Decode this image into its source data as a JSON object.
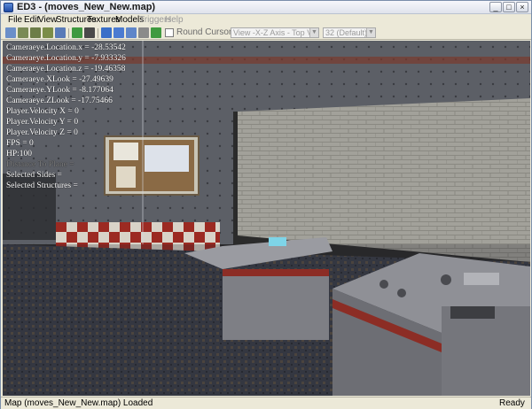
{
  "window": {
    "title": "ED3 - (moves_New_New.map)",
    "minimize_glyph": "_",
    "maximize_glyph": "□",
    "close_glyph": "×"
  },
  "menu": {
    "items": [
      {
        "label": "File",
        "enabled": true
      },
      {
        "label": "Edit",
        "enabled": true
      },
      {
        "label": "View",
        "enabled": true
      },
      {
        "label": "Structures",
        "enabled": true
      },
      {
        "label": "Textures",
        "enabled": true
      },
      {
        "label": "Models",
        "enabled": true
      },
      {
        "label": "Triggers",
        "enabled": false
      },
      {
        "label": "Help",
        "enabled": false
      }
    ]
  },
  "toolbar": {
    "round_cursor_label": "Round Cursor Position",
    "round_cursor_checked": false,
    "view_combo_value": "View -X-Z Axis - Top View",
    "grid_combo_value": "32 (Default)",
    "icons": [
      "new-icon",
      "open-icon",
      "save-icon",
      "save-all-icon",
      "import-icon",
      "export-icon",
      "compile-icon",
      "render-icon",
      "grid-icon",
      "select-icon",
      "move-icon",
      "rotate-icon",
      "scale-icon",
      "texture-icon",
      "light-icon"
    ],
    "colors": {
      "green": "#3f9a3f",
      "blue": "#3a6fc8",
      "gray": "#8a8a8a",
      "dark": "#4a4a4a"
    }
  },
  "overlay": {
    "lines": [
      {
        "text": "Cameraeye.Location.x = -28.53542",
        "dim": false
      },
      {
        "text": "Cameraeye.Location.y = -7.933326",
        "dim": false
      },
      {
        "text": "Cameraeye.Location.z = -19.46358",
        "dim": false
      },
      {
        "text": "Cameraeye.XLook = -27.49639",
        "dim": false
      },
      {
        "text": "Cameraeye.YLook = -8.177064",
        "dim": false
      },
      {
        "text": "Cameraeye.ZLook = -17.75466",
        "dim": false
      },
      {
        "text": "Player.Velocity X = 0",
        "dim": false
      },
      {
        "text": "Player.Velocity Y = 0",
        "dim": false
      },
      {
        "text": "Player.Velocity Z = 0",
        "dim": false
      },
      {
        "text": "FPS = 0",
        "dim": false
      },
      {
        "text": "HP:100",
        "dim": false
      },
      {
        "text": "Distance To Plane =",
        "dim": true
      },
      {
        "text": "Selected Sides =",
        "dim": false
      },
      {
        "text": "Selected Structures =",
        "dim": false
      }
    ]
  },
  "status": {
    "left": "Map (moves_New_New.map) Loaded",
    "right": "Ready"
  },
  "scene_colors": {
    "floor": "#3b3f4a",
    "brick_wall": "#9d9c95",
    "metal_wall": "#5c5f66",
    "checker_red": "#9c2a22",
    "checker_white": "#d9d3c8",
    "console": "#8f9096",
    "corkboard": "#8a6a45"
  }
}
